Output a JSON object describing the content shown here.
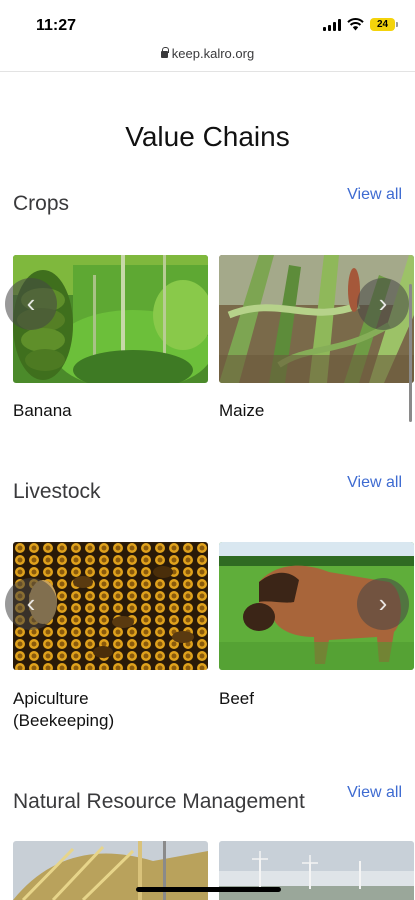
{
  "status": {
    "time": "11:27",
    "battery": "24"
  },
  "browser": {
    "url": "keep.kalro.org"
  },
  "page": {
    "title": "Value Chains"
  },
  "sections": [
    {
      "title": "Crops",
      "view_all": "View all",
      "cards": [
        {
          "label": "Banana"
        },
        {
          "label": "Maize"
        }
      ]
    },
    {
      "title": "Livestock",
      "view_all": "View all",
      "cards": [
        {
          "label": "Apiculture (Beekeeping)"
        },
        {
          "label": "Beef"
        }
      ]
    },
    {
      "title": "Natural Resource Management",
      "view_all": "View all",
      "cards": []
    }
  ],
  "icons": {
    "prev": "chevron-left-icon",
    "next": "chevron-right-icon",
    "lock": "lock-icon",
    "signal": "signal-icon",
    "wifi": "wifi-icon",
    "battery": "battery-icon"
  },
  "colors": {
    "link": "#3e6bd1",
    "battery": "#f4d30b"
  }
}
